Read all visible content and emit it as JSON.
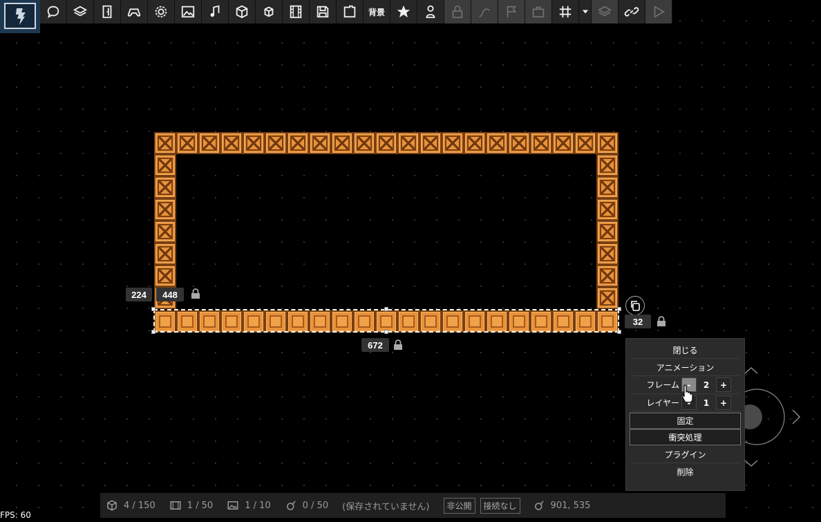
{
  "toolbar": {
    "bg_label": "背景",
    "icons": [
      "chat-bubble-icon",
      "layers-icon",
      "door-icon",
      "gamepad-icon",
      "gear-icon",
      "image-icon",
      "music-note-icon",
      "cube-icon",
      "small-cube-icon",
      "film-icon",
      "save-icon",
      "export-icon",
      "background-text",
      "star-icon",
      "person-icon",
      "lock-icon",
      "path-icon",
      "flag-icon",
      "toolbox-icon",
      "grid-icon",
      "dropdown-arrow-icon",
      "stack-layers-icon",
      "link-icon",
      "play-icon"
    ]
  },
  "canvas": {
    "labels": {
      "x_pos": "224",
      "width": "448",
      "length": "672",
      "tile_size": "32"
    }
  },
  "context_menu": {
    "close": "閉じる",
    "animation": "アニメーション",
    "frame_label": "フレーム",
    "frame_minus": "-",
    "frame_value": "2",
    "frame_plus": "+",
    "layer_label": "レイヤー",
    "layer_minus": "-",
    "layer_value": "1",
    "layer_plus": "+",
    "fix": "固定",
    "collision": "衝突処理",
    "plugin": "プラグイン",
    "delete": "削除"
  },
  "statusbar": {
    "objects": "4 / 150",
    "films": "1 / 50",
    "images": "1 / 10",
    "sounds": "0 / 50",
    "save_status": "(保存されていません)",
    "visibility": "非公開",
    "connection": "接続なし",
    "coords": "901, 535"
  },
  "fps": "FPS: 60",
  "colors": {
    "crate_fill": "#e9923a",
    "crate_border": "#7a3f10",
    "toolbar_bg": "#262626",
    "logo_bg": "#1f3852",
    "menu_bg": "#2b2b2b"
  }
}
